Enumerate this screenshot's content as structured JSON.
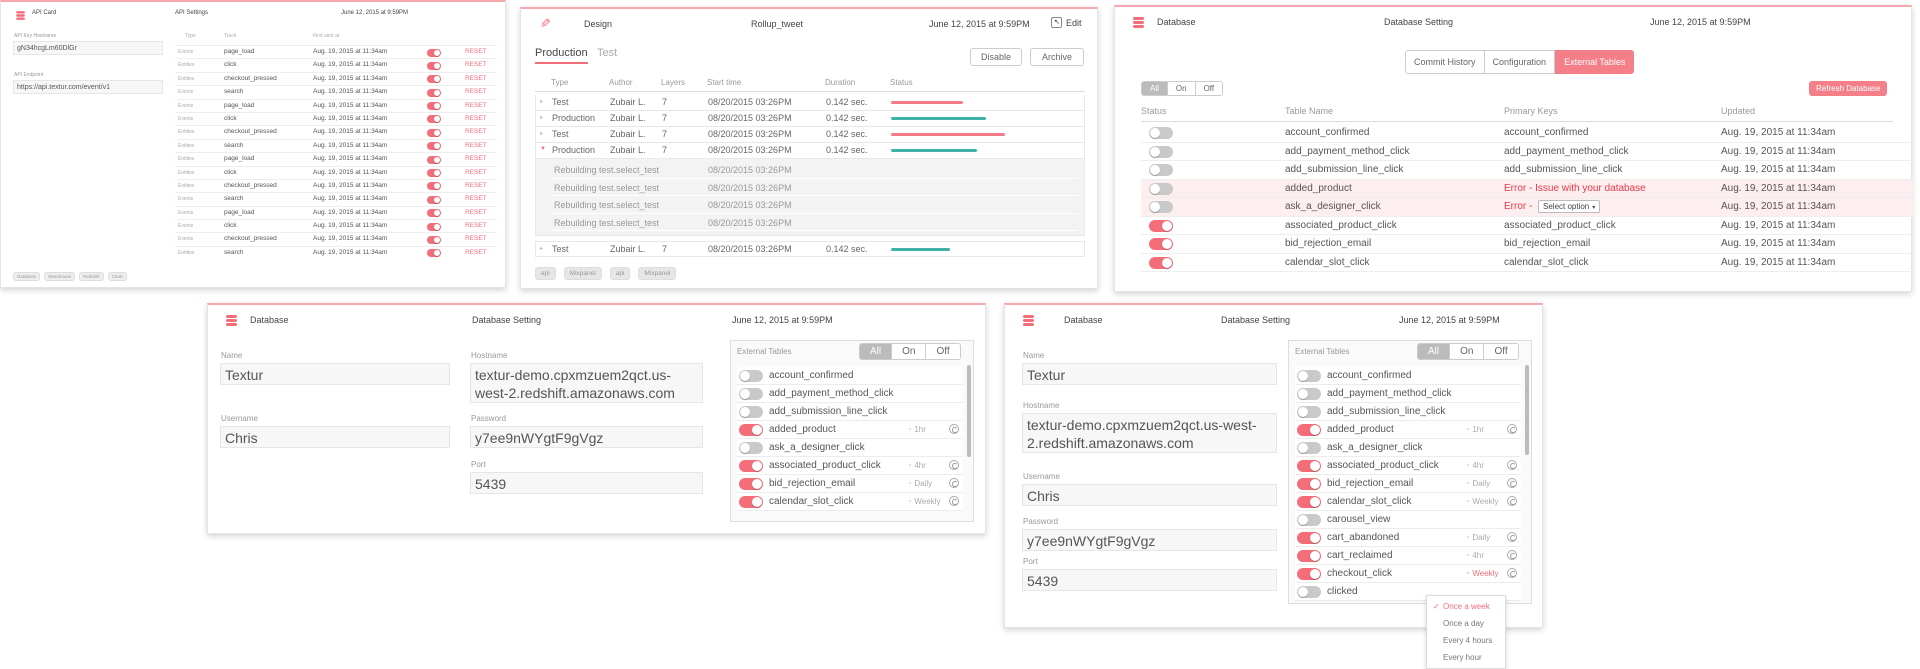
{
  "api_card": {
    "title": "API Card",
    "settings": "API Settings",
    "date": "June 12, 2015 at 9:59PM",
    "hostname_label": "API Key Hostname",
    "hostname_value": "gN34hcgLm60DlGr",
    "endpoint_label": "API Endpoint",
    "endpoint_value": "https://api.textur.com/event/v1",
    "columns": [
      "Type",
      "Track",
      "First sent at"
    ],
    "reset_label": "RESET",
    "rows": [
      {
        "type": "Events",
        "track": "page_load",
        "date": "Aug. 19, 2015 at 11:34am"
      },
      {
        "type": "Entities",
        "track": "click",
        "date": "Aug. 19, 2015 at 11:34am"
      },
      {
        "type": "Entities",
        "track": "checkout_pressed",
        "date": "Aug. 19, 2015 at 11:34am"
      },
      {
        "type": "Events",
        "track": "search",
        "date": "Aug. 19, 2015 at 11:34am"
      },
      {
        "type": "Events",
        "track": "page_load",
        "date": "Aug. 19, 2015 at 11:34am"
      },
      {
        "type": "Events",
        "track": "click",
        "date": "Aug. 19, 2015 at 11:34am"
      },
      {
        "type": "Entities",
        "track": "checkout_pressed",
        "date": "Aug. 19, 2015 at 11:34am"
      },
      {
        "type": "Entities",
        "track": "search",
        "date": "Aug. 19, 2015 at 11:34am"
      },
      {
        "type": "Entities",
        "track": "page_load",
        "date": "Aug. 19, 2015 at 11:34am"
      },
      {
        "type": "Entities",
        "track": "click",
        "date": "Aug. 19, 2015 at 11:34am"
      },
      {
        "type": "Entities",
        "track": "checkout_pressed",
        "date": "Aug. 19, 2015 at 11:34am"
      },
      {
        "type": "Events",
        "track": "search",
        "date": "Aug. 19, 2015 at 11:34am"
      },
      {
        "type": "Events",
        "track": "page_load",
        "date": "Aug. 19, 2015 at 11:34am"
      },
      {
        "type": "Events",
        "track": "click",
        "date": "Aug. 19, 2015 at 11:34am"
      },
      {
        "type": "Events",
        "track": "checkout_pressed",
        "date": "Aug. 19, 2015 at 11:34am"
      },
      {
        "type": "Entities",
        "track": "search",
        "date": "Aug. 19, 2015 at 11:34am"
      }
    ],
    "footer_tags": [
      "Database",
      "Warehouse",
      "Redshift",
      "Chart"
    ]
  },
  "design_card": {
    "title": "Design",
    "subtitle": "Rollup_tweet",
    "date": "June 12, 2015 at 9:59PM",
    "edit_label": "Edit",
    "tabs": [
      "Production",
      "Test"
    ],
    "disable_label": "Disable",
    "archive_label": "Archive",
    "columns": [
      "Type",
      "Author",
      "Layers",
      "Start time",
      "Duration",
      "Status"
    ],
    "rows": [
      {
        "type": "Test",
        "author": "Zubair L.",
        "layers": "7",
        "start": "08/20/2015 03:26PM",
        "duration": "0.142 sec.",
        "status_color": "#f07a85",
        "status_fill": 0.55
      },
      {
        "type": "Production",
        "author": "Zubair L.",
        "layers": "7",
        "start": "08/20/2015 03:26PM",
        "duration": "0.142 sec.",
        "status_color": "#3fb1a6",
        "status_fill": 0.73
      },
      {
        "type": "Test",
        "author": "Zubair L.",
        "layers": "7",
        "start": "08/20/2015 03:26PM",
        "duration": "0.142 sec.",
        "status_color": "#f07a85",
        "status_fill": 0.88
      },
      {
        "type": "Production",
        "author": "Zubair L.",
        "layers": "7",
        "start": "08/20/2015 03:26PM",
        "duration": "0.142 sec.",
        "status_color": "#3fb1a6",
        "status_fill": 0.66
      }
    ],
    "sub_rows": [
      {
        "text": "Rebuilding test.select_test",
        "start": "08/20/2015 03:26PM"
      },
      {
        "text": "Rebuilding test.select_test",
        "start": "08/20/2015 03:26PM"
      },
      {
        "text": "Rebuilding test.select_test",
        "start": "08/20/2015 03:26PM"
      },
      {
        "text": "Rebuilding test.select_test",
        "start": "08/20/2015 03:26PM"
      }
    ],
    "last_row": {
      "type": "Test",
      "author": "Zubair L.",
      "layers": "7",
      "start": "08/20/2015 03:26PM",
      "duration": "0.142 sec.",
      "status_color": "#3fb1a6",
      "status_fill": 0.45
    },
    "footer_tags": [
      "api",
      "Mixpanel",
      "api",
      "Mixpanel"
    ]
  },
  "db_card_top": {
    "title": "Database",
    "settings": "Database Setting",
    "date": "June 12, 2015 at 9:59PM",
    "tabs": [
      "Commit History",
      "Configuration",
      "External Tables"
    ],
    "filter": [
      "All",
      "On",
      "Off"
    ],
    "refresh_label": "Refresh Database",
    "columns": [
      "Status",
      "Table Name",
      "Primary Keys",
      "Updated"
    ],
    "rows": [
      {
        "on": false,
        "name": "account_confirmed",
        "key": "account_confirmed",
        "updated": "Aug. 19, 2015 at 11:34am",
        "error": false
      },
      {
        "on": false,
        "name": "add_payment_method_click",
        "key": "add_payment_method_click",
        "updated": "Aug. 19, 2015 at 11:34am",
        "error": false
      },
      {
        "on": false,
        "name": "add_submission_line_click",
        "key": "add_submission_line_click",
        "updated": "Aug. 19, 2015 at 11:34am",
        "error": false
      },
      {
        "on": false,
        "name": "added_product",
        "key": "Error - Issue with your database",
        "updated": "Aug. 19, 2015 at 11:34am",
        "error": true
      },
      {
        "on": false,
        "name": "ask_a_designer_click",
        "key": "Error -",
        "select": "Select option",
        "updated": "Aug. 19, 2015 at 11:34am",
        "error": true
      },
      {
        "on": true,
        "name": "associated_product_click",
        "key": "associated_product_click",
        "updated": "Aug. 19, 2015 at 11:34am",
        "error": false
      },
      {
        "on": true,
        "name": "bid_rejection_email",
        "key": "bid_rejection_email",
        "updated": "Aug. 19, 2015 at 11:34am",
        "error": false
      },
      {
        "on": true,
        "name": "calendar_slot_click",
        "key": "calendar_slot_click",
        "updated": "Aug. 19, 2015 at 11:34am",
        "error": false
      }
    ]
  },
  "db_card_left": {
    "title": "Database",
    "settings": "Database Setting",
    "date": "June 12, 2015 at 9:59PM",
    "name_label": "Name",
    "name_value": "Textur",
    "username_label": "Username",
    "username_value": "Chris",
    "hostname_label": "Hostname",
    "hostname_value": "textur-demo.cpxmzuem2qct.us-west-2.redshift.amazonaws.com",
    "password_label": "Password",
    "password_value": "y7ee9nWYgtF9gVgz",
    "port_label": "Port",
    "port_value": "5439",
    "ext_label": "External Tables",
    "filter": [
      "All",
      "On",
      "Off"
    ],
    "tables": [
      {
        "on": false,
        "name": "account_confirmed",
        "freq": ""
      },
      {
        "on": false,
        "name": "add_payment_method_click",
        "freq": ""
      },
      {
        "on": false,
        "name": "add_submission_line_click",
        "freq": ""
      },
      {
        "on": true,
        "name": "added_product",
        "freq": "1hr"
      },
      {
        "on": false,
        "name": "ask_a_designer_click",
        "freq": ""
      },
      {
        "on": true,
        "name": "associated_product_click",
        "freq": "4hr"
      },
      {
        "on": true,
        "name": "bid_rejection_email",
        "freq": "Daily"
      },
      {
        "on": true,
        "name": "calendar_slot_click",
        "freq": "Weekly"
      }
    ]
  },
  "db_card_right": {
    "title": "Database",
    "settings": "Database Setting",
    "date": "June 12, 2015 at 9:59PM",
    "name_label": "Name",
    "name_value": "Textur",
    "hostname_label": "Hostname",
    "hostname_value": "textur-demo.cpxmzuem2qct.us-west-2.redshift.amazonaws.com",
    "username_label": "Username",
    "username_value": "Chris",
    "password_label": "Password",
    "password_value": "y7ee9nWYgtF9gVgz",
    "port_label": "Port",
    "port_value": "5439",
    "ext_label": "External Tables",
    "filter": [
      "All",
      "On",
      "Off"
    ],
    "tables": [
      {
        "on": false,
        "name": "account_confirmed",
        "freq": ""
      },
      {
        "on": false,
        "name": "add_payment_method_click",
        "freq": ""
      },
      {
        "on": false,
        "name": "add_submission_line_click",
        "freq": ""
      },
      {
        "on": true,
        "name": "added_product",
        "freq": "1hr"
      },
      {
        "on": false,
        "name": "ask_a_designer_click",
        "freq": ""
      },
      {
        "on": true,
        "name": "associated_product_click",
        "freq": "4hr"
      },
      {
        "on": true,
        "name": "bid_rejection_email",
        "freq": "Daily"
      },
      {
        "on": true,
        "name": "calendar_slot_click",
        "freq": "Weekly"
      },
      {
        "on": false,
        "name": "carousel_view",
        "freq": ""
      },
      {
        "on": true,
        "name": "cart_abandoned",
        "freq": "Daily"
      },
      {
        "on": true,
        "name": "cart_reclaimed",
        "freq": "4hr"
      },
      {
        "on": true,
        "name": "checkout_click",
        "freq": "Weekly"
      },
      {
        "on": false,
        "name": "clicked",
        "freq": ""
      }
    ],
    "dropdown": [
      "Once a week",
      "Once a day",
      "Every 4 hours",
      "Every hour"
    ],
    "dropdown_selected": "✓"
  },
  "colors": {
    "accent": "#f46e79",
    "teal": "#3fb1a6",
    "error_bg": "#fdeef0"
  }
}
